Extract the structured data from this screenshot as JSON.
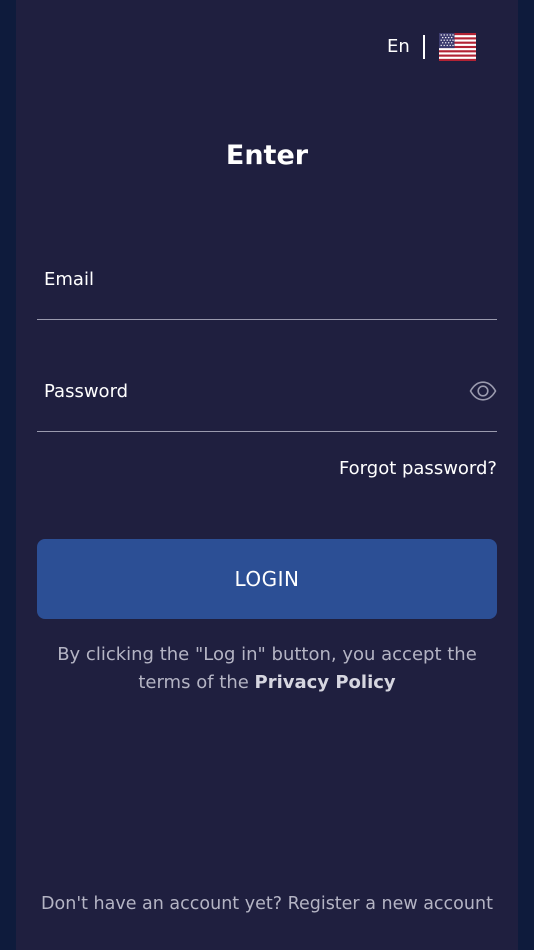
{
  "language": {
    "code": "En",
    "flag": "us-flag-icon"
  },
  "title": "Enter",
  "form": {
    "email_placeholder": "Email",
    "password_placeholder": "Password",
    "forgot_password": "Forgot password?",
    "login_button": "LOGIN"
  },
  "consent": {
    "text": "By clicking the \"Log in\" button, you accept the terms of the",
    "policy_link": "Privacy Policy"
  },
  "register": {
    "prompt": "Don't have an account yet?",
    "link": "Register a new account"
  },
  "colors": {
    "outer_background": "#0e1b3c",
    "panel_background": "#1f1f3f",
    "button": "#2c4f95",
    "text": "#ffffff",
    "muted_text": "#b4b4c4"
  }
}
